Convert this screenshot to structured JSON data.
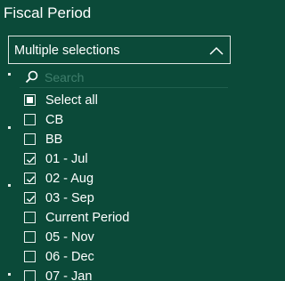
{
  "slicer": {
    "title": "Fiscal Period",
    "dropdown_value": "Multiple selections",
    "search_placeholder": "Search",
    "items": [
      {
        "label": "Select all",
        "state": "partial"
      },
      {
        "label": "CB",
        "state": "unchecked"
      },
      {
        "label": "BB",
        "state": "unchecked"
      },
      {
        "label": "01 - Jul",
        "state": "checked"
      },
      {
        "label": "02 - Aug",
        "state": "checked"
      },
      {
        "label": "03 - Sep",
        "state": "checked"
      },
      {
        "label": "Current Period",
        "state": "unchecked"
      },
      {
        "label": "05 - Nov",
        "state": "unchecked"
      },
      {
        "label": "06 - Dec",
        "state": "unchecked"
      },
      {
        "label": "07 - Jan",
        "state": "unchecked"
      }
    ]
  },
  "icons": {
    "dropdown": "chevron-up-icon",
    "search": "search-icon"
  },
  "colors": {
    "background": "#0b4a39",
    "text": "#ffffff",
    "placeholder": "#3f7e6c",
    "border": "#dfe6e2"
  }
}
